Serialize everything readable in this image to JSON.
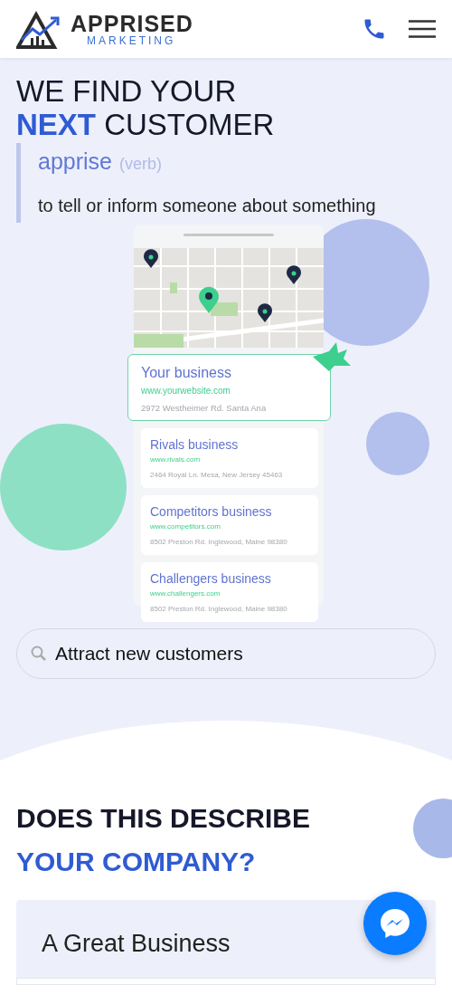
{
  "header": {
    "logo_title": "APPRISED",
    "logo_subtitle": "MARKETING"
  },
  "hero": {
    "headline_lines": [
      "WE FIND YOUR",
      "**NEXT** CUSTOMER"
    ],
    "word": "apprise",
    "word_class": "(verb)",
    "definition": "to tell or inform someone about something"
  },
  "listings": [
    {
      "name": "Your business",
      "url": "www.yourwebsite.com",
      "address": "2972 Westheimer Rd. Santa Ana",
      "selected": true
    },
    {
      "name": "Rivals business",
      "url": "www.rivals.com",
      "address": "2464 Royal Ln. Mesa, New Jersey 45463",
      "selected": false
    },
    {
      "name": "Competitors business",
      "url": "www.competitors.com",
      "address": "8502 Preston Rd. Inglewood, Maine 98380",
      "selected": false
    },
    {
      "name": "Challengers business",
      "url": "www.challengers.com",
      "address": "8502 Preston Rd. Inglewood, Maine 98380",
      "selected": false
    }
  ],
  "search": {
    "value": "Attract new customers"
  },
  "section": {
    "heading_lines": [
      "DOES THIS DESCRIBE",
      "YOUR COMPANY?"
    ],
    "card_title": "A Great Business"
  }
}
